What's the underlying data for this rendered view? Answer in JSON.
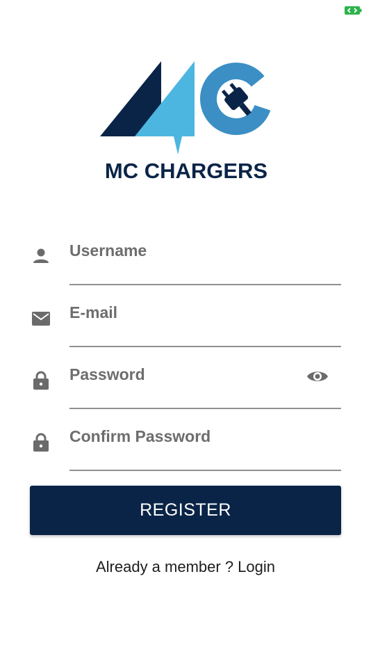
{
  "brand": {
    "name": "MC CHARGERS",
    "colors": {
      "navy": "#0a2447",
      "light_blue": "#4db6e0",
      "mid_blue": "#3b8fc4"
    }
  },
  "status_bar": {
    "icon": "battery-charging-icon",
    "color": "#2db34a"
  },
  "form": {
    "username": {
      "placeholder": "Username",
      "icon": "person-icon"
    },
    "email": {
      "placeholder": "E-mail",
      "icon": "mail-icon"
    },
    "password": {
      "placeholder": "Password",
      "icon": "lock-icon",
      "toggle_icon": "eye-icon"
    },
    "confirm_password": {
      "placeholder": "Confirm Password",
      "icon": "lock-icon"
    }
  },
  "actions": {
    "register_label": "REGISTER",
    "login_prompt": "Already a member ? ",
    "login_label": "Login"
  }
}
